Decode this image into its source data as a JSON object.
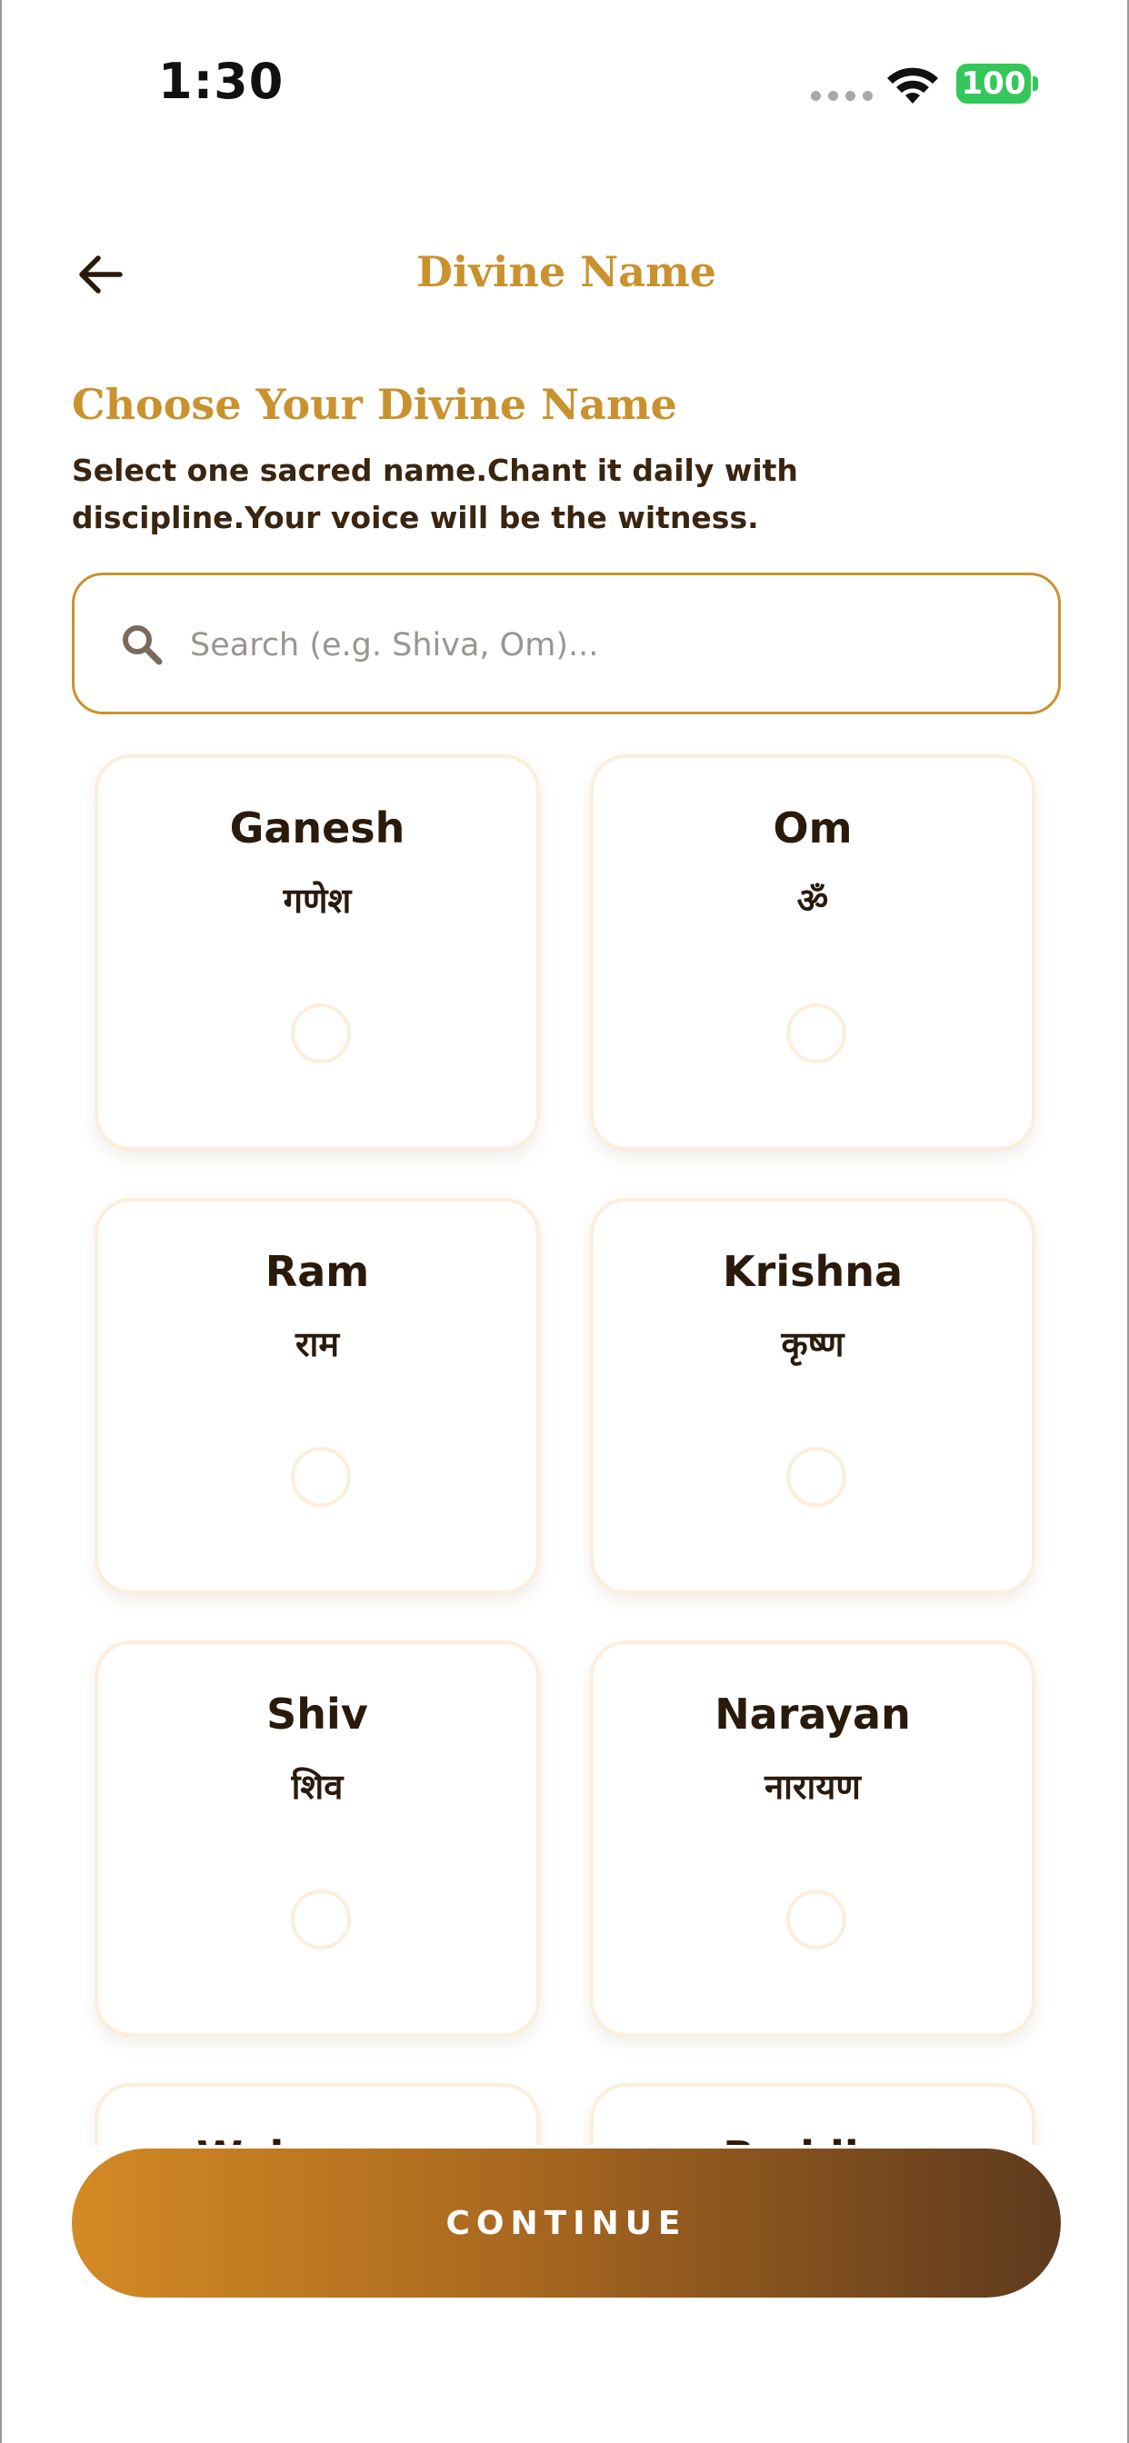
{
  "status_bar": {
    "time": "1:30",
    "battery": "100"
  },
  "header": {
    "back_icon": "arrow-left-icon",
    "title": "Divine Name"
  },
  "intro": {
    "heading": "Choose Your Divine Name",
    "description": "Select one sacred name.Chant it daily with discipline.Your voice will be the witness."
  },
  "search": {
    "icon": "search-icon",
    "placeholder": "Search (e.g. Shiva, Om)...",
    "value": ""
  },
  "names": [
    {
      "name": "Ganesh",
      "native": "गणेश",
      "selected": false
    },
    {
      "name": "Om",
      "native": "ॐ",
      "selected": false
    },
    {
      "name": "Ram",
      "native": "राम",
      "selected": false
    },
    {
      "name": "Krishna",
      "native": "कृष्ण",
      "selected": false
    },
    {
      "name": "Shiv",
      "native": "शिव",
      "selected": false
    },
    {
      "name": "Narayan",
      "native": "नारायण",
      "selected": false
    },
    {
      "name": "Waheguru",
      "native": "",
      "selected": false
    },
    {
      "name": "Buddha",
      "native": "",
      "selected": false
    }
  ],
  "colors": {
    "accent_gold": "#c9922e",
    "text_dark": "#2a1a0c",
    "card_border": "#fbeedb",
    "button_gradient_start": "#d38a24",
    "button_gradient_end": "#5e3a1e"
  },
  "footer": {
    "continue_label": "CONTINUE"
  }
}
